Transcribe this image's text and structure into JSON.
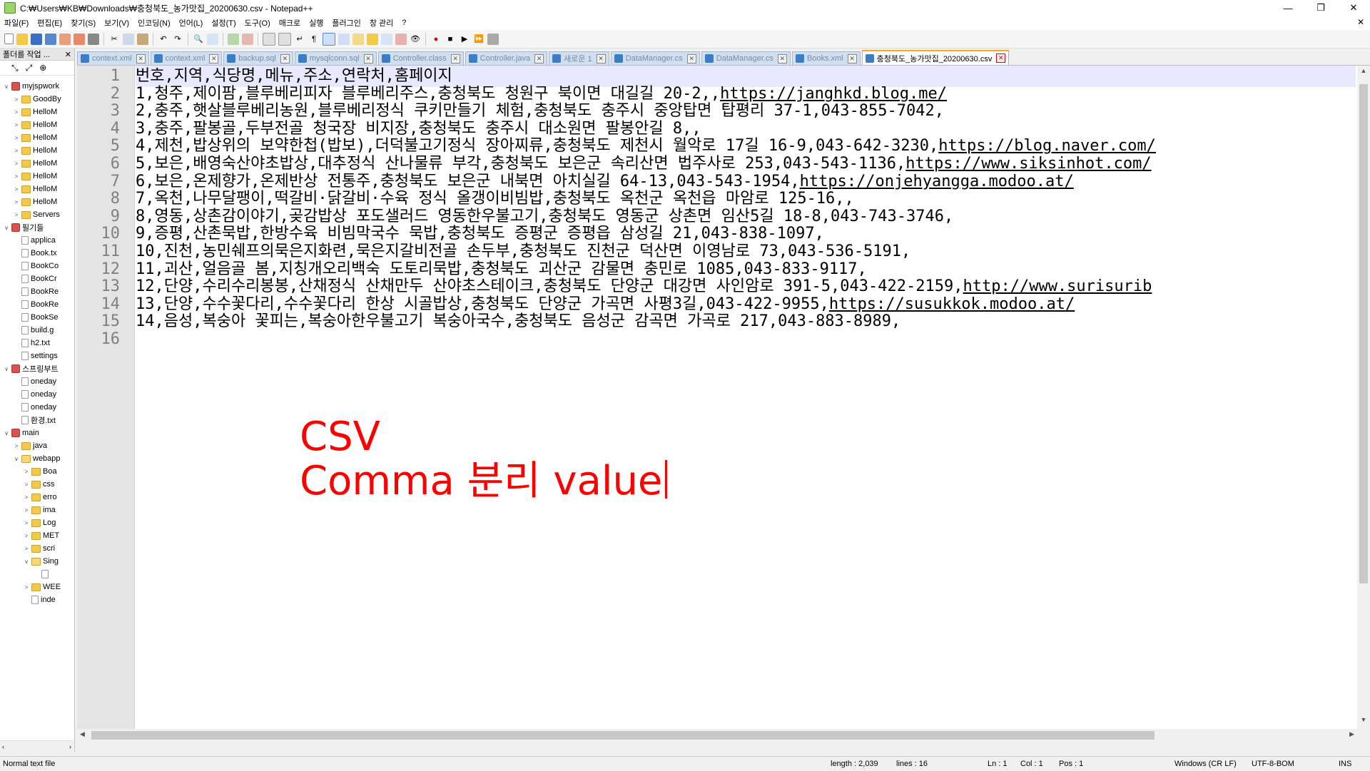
{
  "window": {
    "title": "C:₩Users₩KB₩Downloads₩충청북도_농가맛집_20200630.csv - Notepad++",
    "controls": [
      "—",
      "❐",
      "✕"
    ]
  },
  "menu": [
    "파일(F)",
    "편집(E)",
    "찾기(S)",
    "보기(V)",
    "인코딩(N)",
    "언어(L)",
    "설정(T)",
    "도구(O)",
    "매크로",
    "실행",
    "플러그인",
    "창 관리",
    "?"
  ],
  "menu_close": "✕",
  "panel": {
    "title": "폴더를 작업 ...",
    "close": "✕",
    "tree": [
      {
        "indent": 0,
        "tw": "∨",
        "icon": "ws",
        "label": "myjspwork"
      },
      {
        "indent": 1,
        "tw": ">",
        "icon": "folder",
        "label": "GoodBy"
      },
      {
        "indent": 1,
        "tw": ">",
        "icon": "folder",
        "label": "HelloM"
      },
      {
        "indent": 1,
        "tw": ">",
        "icon": "folder",
        "label": "HelloM"
      },
      {
        "indent": 1,
        "tw": ">",
        "icon": "folder",
        "label": "HelloM"
      },
      {
        "indent": 1,
        "tw": ">",
        "icon": "folder",
        "label": "HelloM"
      },
      {
        "indent": 1,
        "tw": ">",
        "icon": "folder",
        "label": "HelloM"
      },
      {
        "indent": 1,
        "tw": ">",
        "icon": "folder",
        "label": "HelloM"
      },
      {
        "indent": 1,
        "tw": ">",
        "icon": "folder",
        "label": "HelloM"
      },
      {
        "indent": 1,
        "tw": ">",
        "icon": "folder",
        "label": "HelloM"
      },
      {
        "indent": 1,
        "tw": ">",
        "icon": "folder",
        "label": "Servers"
      },
      {
        "indent": 0,
        "tw": "∨",
        "icon": "ws",
        "label": "필기들"
      },
      {
        "indent": 1,
        "tw": "",
        "icon": "file",
        "label": "applica"
      },
      {
        "indent": 1,
        "tw": "",
        "icon": "file",
        "label": "Book.tx"
      },
      {
        "indent": 1,
        "tw": "",
        "icon": "file",
        "label": "BookCo"
      },
      {
        "indent": 1,
        "tw": "",
        "icon": "file",
        "label": "BookCr"
      },
      {
        "indent": 1,
        "tw": "",
        "icon": "file",
        "label": "BookRe"
      },
      {
        "indent": 1,
        "tw": "",
        "icon": "file",
        "label": "BookRe"
      },
      {
        "indent": 1,
        "tw": "",
        "icon": "file",
        "label": "BookSe"
      },
      {
        "indent": 1,
        "tw": "",
        "icon": "file",
        "label": "build.g"
      },
      {
        "indent": 1,
        "tw": "",
        "icon": "file",
        "label": "h2.txt"
      },
      {
        "indent": 1,
        "tw": "",
        "icon": "file",
        "label": "settings"
      },
      {
        "indent": 0,
        "tw": "∨",
        "icon": "ws",
        "label": "스프링부트"
      },
      {
        "indent": 1,
        "tw": "",
        "icon": "file",
        "label": "oneday"
      },
      {
        "indent": 1,
        "tw": "",
        "icon": "file",
        "label": "oneday"
      },
      {
        "indent": 1,
        "tw": "",
        "icon": "file",
        "label": "oneday"
      },
      {
        "indent": 1,
        "tw": "",
        "icon": "file",
        "label": "환경.txt"
      },
      {
        "indent": 0,
        "tw": "∨",
        "icon": "ws",
        "label": "main"
      },
      {
        "indent": 1,
        "tw": ">",
        "icon": "folder",
        "label": "java"
      },
      {
        "indent": 1,
        "tw": "∨",
        "icon": "open",
        "label": "webapp"
      },
      {
        "indent": 2,
        "tw": ">",
        "icon": "folder",
        "label": "Boa"
      },
      {
        "indent": 2,
        "tw": ">",
        "icon": "folder",
        "label": "css"
      },
      {
        "indent": 2,
        "tw": ">",
        "icon": "folder",
        "label": "erro"
      },
      {
        "indent": 2,
        "tw": ">",
        "icon": "folder",
        "label": "ima"
      },
      {
        "indent": 2,
        "tw": ">",
        "icon": "folder",
        "label": "Log"
      },
      {
        "indent": 2,
        "tw": ">",
        "icon": "folder",
        "label": "MET"
      },
      {
        "indent": 2,
        "tw": ">",
        "icon": "folder",
        "label": "scri"
      },
      {
        "indent": 2,
        "tw": "∨",
        "icon": "open",
        "label": "Sing"
      },
      {
        "indent": 3,
        "tw": "",
        "icon": "file",
        "label": ""
      },
      {
        "indent": 2,
        "tw": ">",
        "icon": "folder",
        "label": "WEE"
      },
      {
        "indent": 2,
        "tw": "",
        "icon": "file",
        "label": "inde"
      }
    ]
  },
  "tabs": [
    {
      "label": "context.xml",
      "active": false
    },
    {
      "label": "context.xml",
      "active": false
    },
    {
      "label": "backup.sql",
      "active": false
    },
    {
      "label": "mysqlconn.sql",
      "active": false
    },
    {
      "label": "Controller.class",
      "active": false
    },
    {
      "label": "Controller.java",
      "active": false
    },
    {
      "label": "새로운 1",
      "active": false
    },
    {
      "label": "DataManager.cs",
      "active": false
    },
    {
      "label": "DataManager.cs",
      "active": false
    },
    {
      "label": "Books.xml",
      "active": false
    },
    {
      "label": "충청북도_농가맛집_20200630.csv",
      "active": true
    }
  ],
  "editor": {
    "line_numbers": [
      "1",
      "2",
      "3",
      "4",
      "5",
      "6",
      "7",
      "8",
      "9",
      "10",
      "11",
      "12",
      "13",
      "14",
      "15",
      "16"
    ],
    "lines": [
      {
        "text": "번호,지역,식당명,메뉴,주소,연락처,홈페이지",
        "url": ""
      },
      {
        "text": "1,청주,제이팜,블루베리피자 블루베리주스,충청북도 청원구 북이면 대길길 20-2,,",
        "url": "https://janghkd.blog.me/"
      },
      {
        "text": "2,충주,햇살블루베리농원,블루베리정식 쿠키만들기 체험,충청북도 충주시 중앙탑면 탑평리 37-1,043-855-7042,",
        "url": ""
      },
      {
        "text": "3,충주,팔봉골,두부전골 청국장 비지장,충청북도 충주시 대소원면 팔봉안길 8,,",
        "url": ""
      },
      {
        "text": "4,제천,밥상위의 보약한첩(밥보),더덕불고기정식 장아찌류,충청북도 제천시 월악로 17길 16-9,043-642-3230,",
        "url": "https://blog.naver.com/"
      },
      {
        "text": "5,보은,배영숙산야초밥상,대추정식 산나물류 부각,충청북도 보은군 속리산면 법주사로 253,043-543-1136,",
        "url": "https://www.siksinhot.com/"
      },
      {
        "text": "6,보은,온제향가,온제반상 전통주,충청북도 보은군 내북면 아치실길 64-13,043-543-1954,",
        "url": "https://onjehyangga.modoo.at/"
      },
      {
        "text": "7,옥천,나무달팽이,떡갈비·닭갈비·수육 정식 올갱이비빔밥,충청북도 옥천군 옥천읍 마암로 125-16,,",
        "url": ""
      },
      {
        "text": "8,영동,상촌감이야기,곶감밥상 포도샐러드 영동한우불고기,충청북도 영동군 상촌면 임산5길 18-8,043-743-3746,",
        "url": ""
      },
      {
        "text": "9,증평,산촌묵밥,한방수육 비빔막국수 묵밥,충청북도 증평군 증평읍 삼성길 21,043-838-1097,",
        "url": ""
      },
      {
        "text": "10,진천,농민쉐프의묵은지화련,묵은지갈비전골 손두부,충청북도 진천군 덕산면 이영남로 73,043-536-5191,",
        "url": ""
      },
      {
        "text": "11,괴산,얼음골 봄,지칭개오리백숙 도토리묵밥,충청북도 괴산군 감물면 충민로 1085,043-833-9117,",
        "url": ""
      },
      {
        "text": "12,단양,수리수리봉봉,산채정식 산채만두 산야초스테이크,충청북도 단양군 대강면 사인암로 391-5,043-422-2159,",
        "url": "http://www.surisurib"
      },
      {
        "text": "13,단양,수수꽃다리,수수꽃다리 한상 시골밥상,충청북도 단양군 가곡면 사평3길,043-422-9955,",
        "url": "https://susukkok.modoo.at/"
      },
      {
        "text": "14,음성,복숭아 꽃피는,복숭아한우불고기 복숭아국수,충청북도 음성군 감곡면 가곡로 217,043-883-8989,",
        "url": ""
      },
      {
        "text": "",
        "url": ""
      }
    ],
    "overlay": {
      "line1": "CSV",
      "line2": "Comma 분리 value"
    }
  },
  "status": {
    "file_type": "Normal text file",
    "length": "length : 2,039",
    "lines": "lines : 16",
    "ln": "Ln : 1",
    "col": "Col : 1",
    "pos": "Pos : 1",
    "eol": "Windows (CR LF)",
    "encoding": "UTF-8-BOM",
    "mode": "INS"
  },
  "colors": {
    "overlay_text": "#ff0000",
    "current_line": "#e8e8ff",
    "active_tab_accent": "#f5a623"
  }
}
